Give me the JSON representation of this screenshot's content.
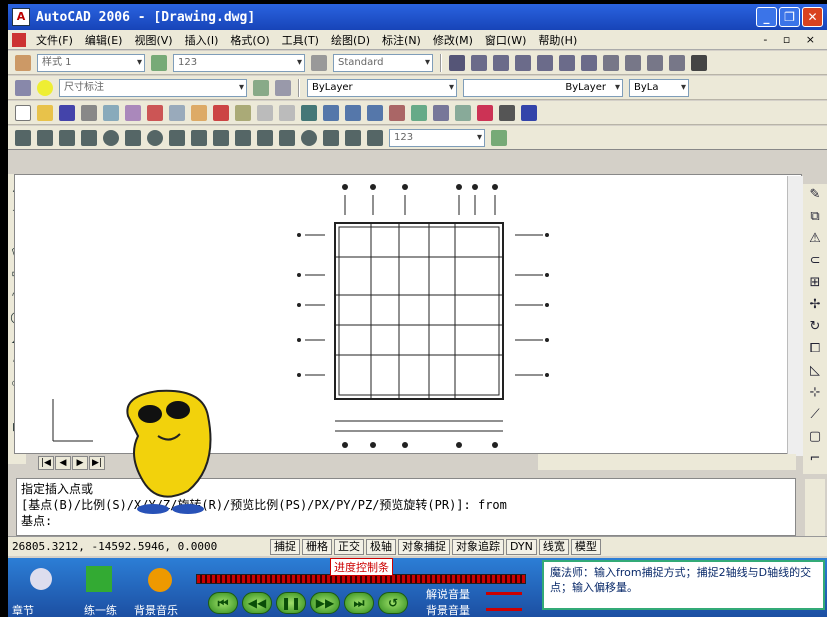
{
  "window": {
    "title": "AutoCAD 2006 - [Drawing.dwg]"
  },
  "menu": {
    "items": [
      "文件(F)",
      "编辑(E)",
      "视图(V)",
      "插入(I)",
      "格式(O)",
      "工具(T)",
      "绘图(D)",
      "标注(N)",
      "修改(M)",
      "窗口(W)",
      "帮助(H)"
    ],
    "doc_controls": "- ▫ ×"
  },
  "toolbar_styles": {
    "text_style": "样式 1",
    "dim_style": "123",
    "table_style": "Standard"
  },
  "toolbar_layers": {
    "layer": "尺寸标注",
    "color": "ByLayer",
    "linetype": "ByLayer",
    "lineweight": "ByLa"
  },
  "toolbar_dim": {
    "dim_combo": "123"
  },
  "command": {
    "line1": "指定插入点或",
    "line2": "[基点(B)/比例(S)/X/Y/Z/旋转(R)/预览比例(PS)/PX/PY/PZ/预览旋转(PR)]:   from",
    "line3": "基点:"
  },
  "status": {
    "coords": "26805.3212, -14592.5946, 0.0000",
    "buttons": [
      "捕捉",
      "栅格",
      "正交",
      "极轴",
      "对象捕捉",
      "对象追踪",
      "DYN",
      "线宽",
      "模型"
    ]
  },
  "player": {
    "progress_label": "进度控制条",
    "practice_label": "练一练",
    "music_label": "背景音乐",
    "chapter_label": "章节",
    "narration_volume": "解说音量",
    "background_volume": "背景音量",
    "tip": "魔法师：输入from捕捉方式；捕捉2轴线与D轴线的交点；输入偏移量。"
  },
  "colors": {
    "titlebar": "#1f52cc",
    "player_bg": "#2466bf",
    "accent_red": "#cc0000"
  }
}
